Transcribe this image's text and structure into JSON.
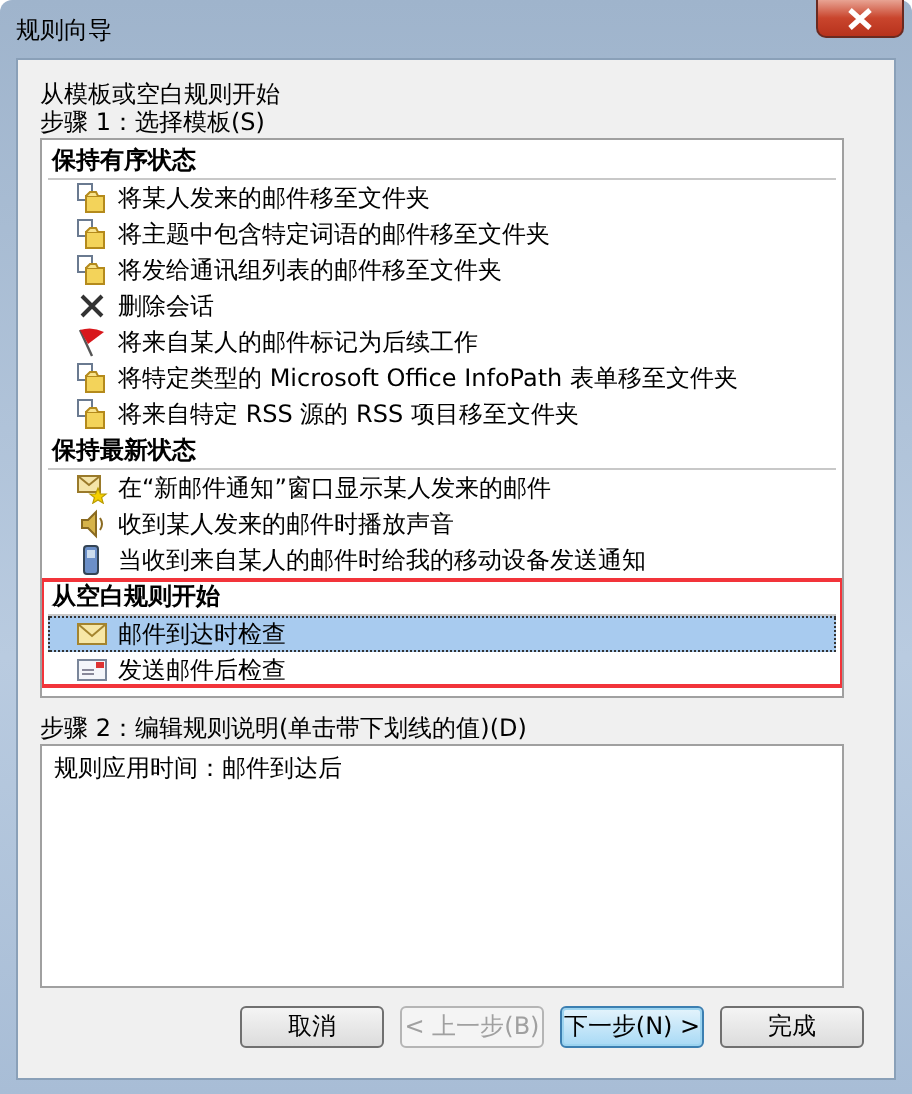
{
  "window": {
    "title": "规则向导"
  },
  "intro": "从模板或空白规则开始",
  "step1_label": "步骤 1：选择模板(S)",
  "template_groups": [
    {
      "heading": "保持有序状态",
      "highlighted": false,
      "items": [
        {
          "kind": "move",
          "label": "将某人发来的邮件移至文件夹",
          "selected": false
        },
        {
          "kind": "move",
          "label": "将主题中包含特定词语的邮件移至文件夹",
          "selected": false
        },
        {
          "kind": "move",
          "label": "将发给通讯组列表的邮件移至文件夹",
          "selected": false
        },
        {
          "kind": "delete",
          "label": "删除会话",
          "selected": false
        },
        {
          "kind": "flag",
          "label": "将来自某人的邮件标记为后续工作",
          "selected": false
        },
        {
          "kind": "move",
          "label": "将特定类型的 Microsoft Office InfoPath 表单移至文件夹",
          "selected": false
        },
        {
          "kind": "move",
          "label": "将来自特定 RSS 源的 RSS 项目移至文件夹",
          "selected": false
        }
      ]
    },
    {
      "heading": "保持最新状态",
      "highlighted": false,
      "items": [
        {
          "kind": "alert",
          "label": "在“新邮件通知”窗口显示某人发来的邮件",
          "selected": false
        },
        {
          "kind": "sound",
          "label": "收到某人发来的邮件时播放声音",
          "selected": false
        },
        {
          "kind": "mobile",
          "label": "当收到来自某人的邮件时给我的移动设备发送通知",
          "selected": false
        }
      ]
    },
    {
      "heading": "从空白规则开始",
      "highlighted": true,
      "items": [
        {
          "kind": "mail",
          "label": "邮件到达时检查",
          "selected": true
        },
        {
          "kind": "sent",
          "label": "发送邮件后检查",
          "selected": false
        }
      ]
    }
  ],
  "step2_label": "步骤 2：编辑规则说明(单击带下划线的值)(D)",
  "description": "规则应用时间：邮件到达后",
  "buttons": [
    {
      "label": "取消",
      "disabled": false,
      "default": false
    },
    {
      "label": "< 上一步(B)",
      "disabled": true,
      "default": false
    },
    {
      "label": "下一步(N) >",
      "disabled": false,
      "default": true
    },
    {
      "label": "完成",
      "disabled": false,
      "default": false
    }
  ]
}
